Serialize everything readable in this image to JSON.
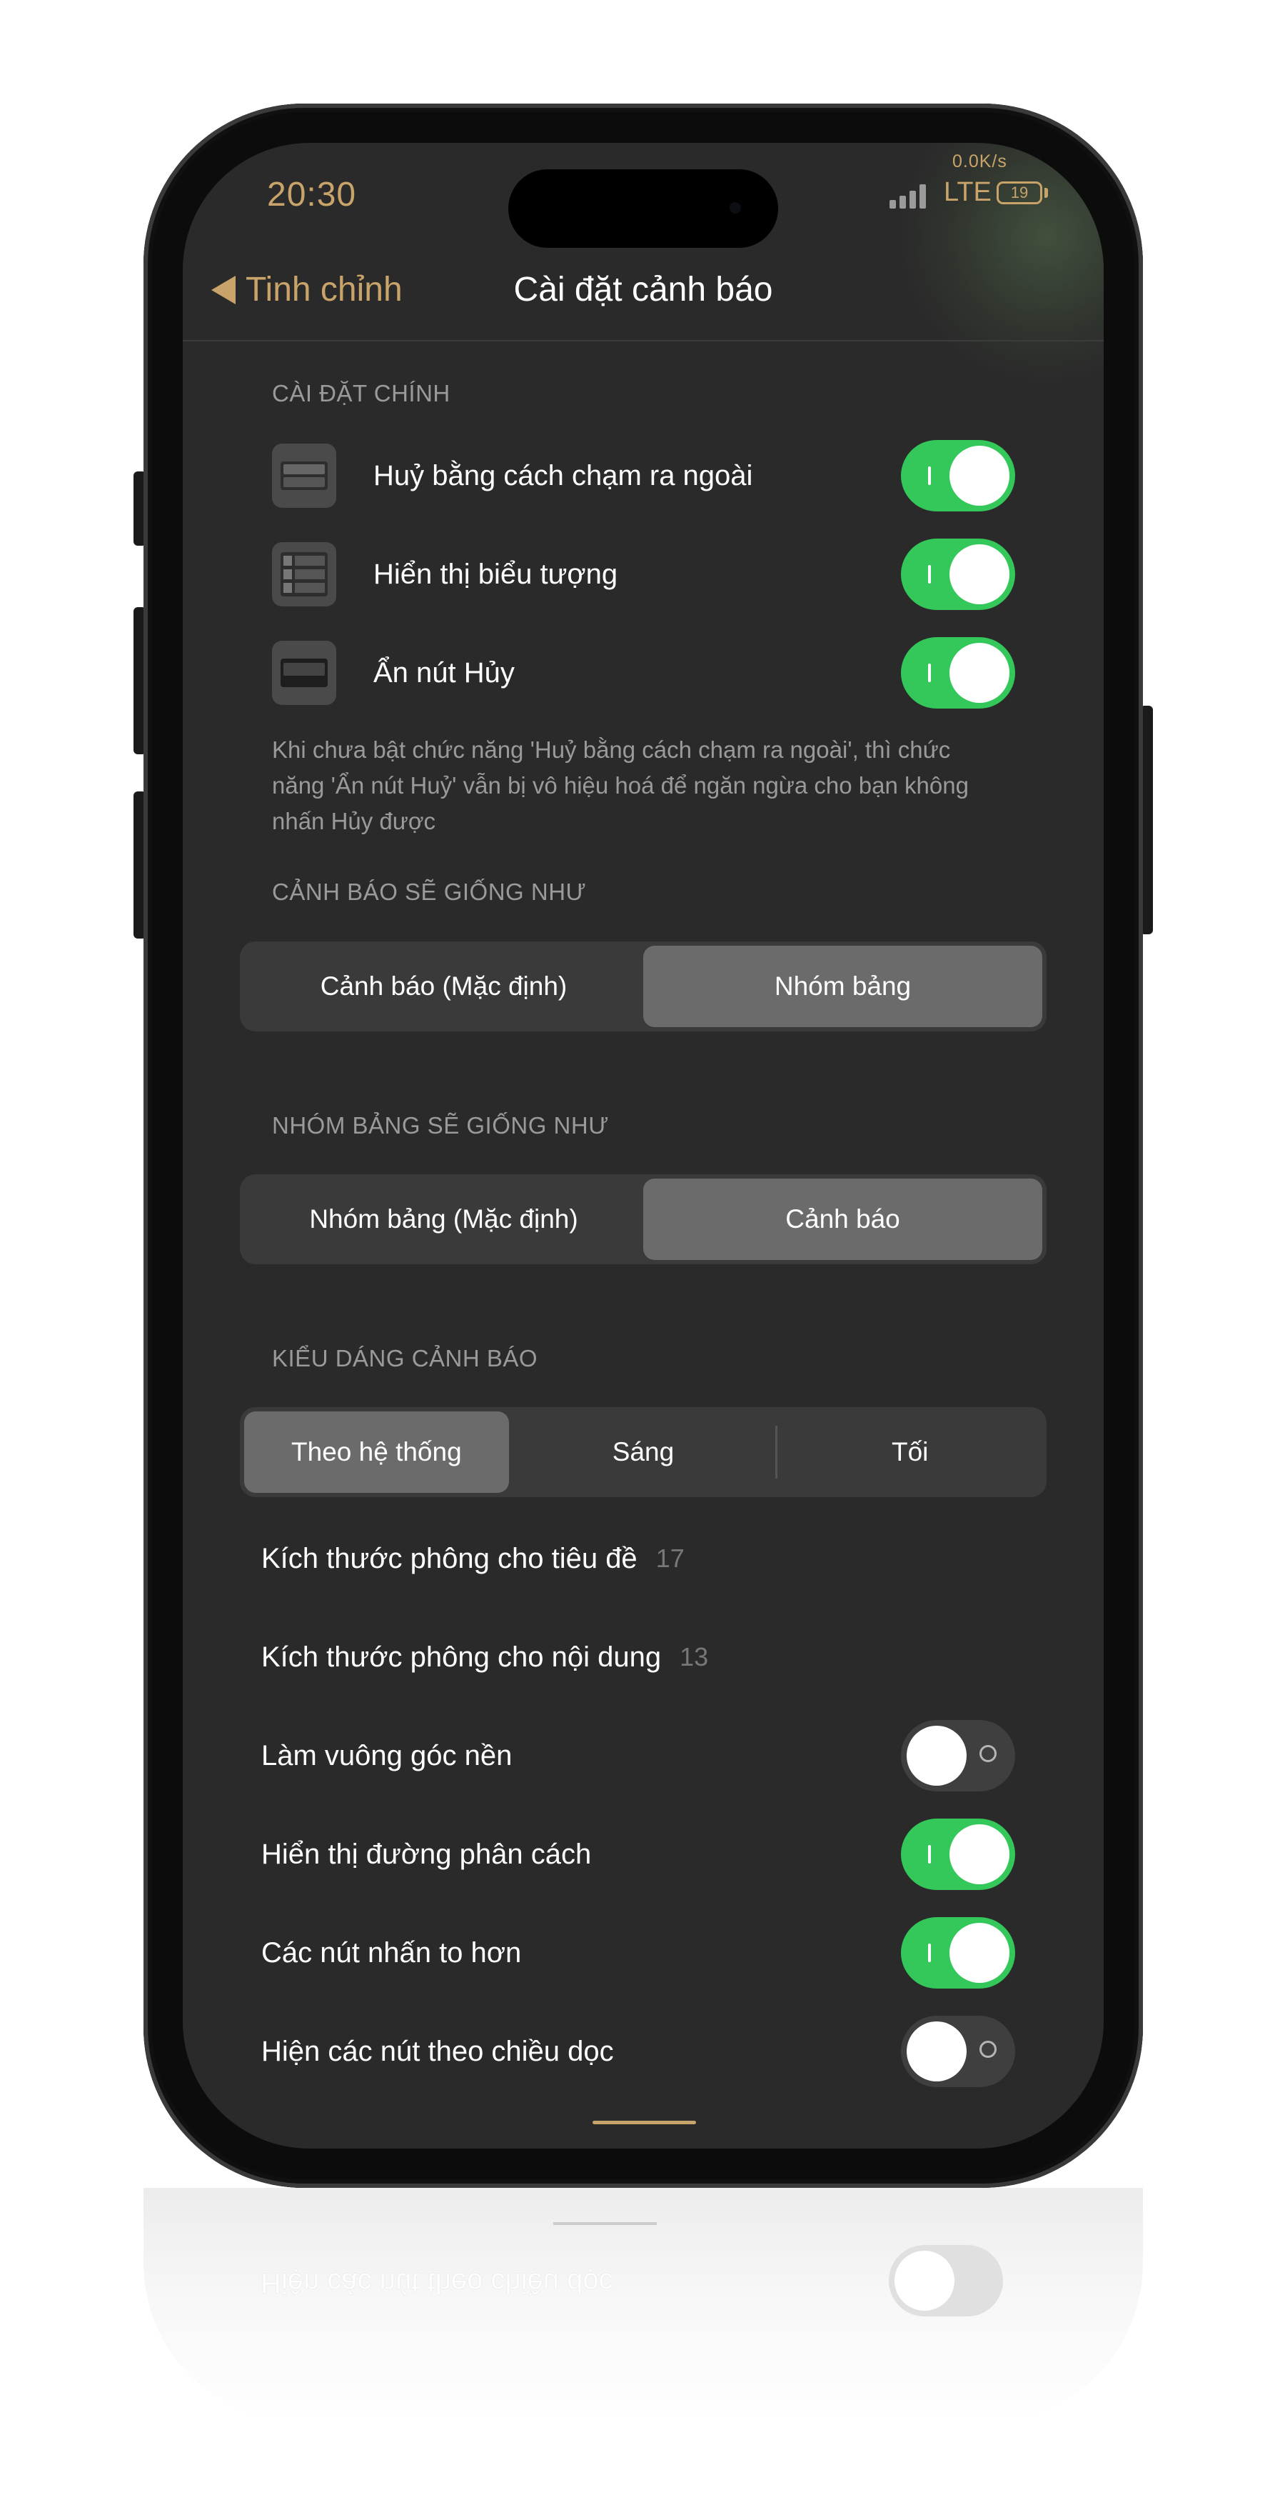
{
  "status_bar": {
    "time": "20:30",
    "net_speed": "0.0K/s",
    "network": "LTE",
    "battery": "19"
  },
  "nav": {
    "back_label": "Tinh chỉnh",
    "title": "Cài đặt cảnh báo"
  },
  "main_settings": {
    "header": "CÀI ĐẶT CHÍNH",
    "rows": [
      {
        "label": "Huỷ bằng cách chạm ra ngoài",
        "icon": "tap-outside-icon",
        "on": true
      },
      {
        "label": "Hiển thị biểu tượng",
        "icon": "list-icon",
        "on": true
      },
      {
        "label": "Ẩn nút Hủy",
        "icon": "hide-button-icon",
        "on": true
      }
    ],
    "footnote": "Khi chưa bật chức năng 'Huỷ bằng cách chạm ra ngoài', thì chức năng 'Ẩn nút Huỷ' vẫn bị vô hiệu hoá để ngăn ngừa cho bạn không nhấn Hủy được"
  },
  "alert_as": {
    "header": "CẢNH BÁO SẼ GIỐNG NHƯ",
    "options": [
      "Cảnh báo (Mặc định)",
      "Nhóm bảng"
    ],
    "selected": 1
  },
  "sheet_as": {
    "header": "NHÓM BẢNG SẼ GIỐNG NHƯ",
    "options": [
      "Nhóm bảng (Mặc định)",
      "Cảnh báo"
    ],
    "selected": 1
  },
  "alert_style": {
    "header": "KIỂU DÁNG CẢNH BÁO",
    "options": [
      "Theo hệ thống",
      "Sáng",
      "Tối"
    ],
    "selected": 0
  },
  "font_sizes": [
    {
      "label": "Kích thước phông cho tiêu đề",
      "value": "17"
    },
    {
      "label": "Kích thước phông cho nội dung",
      "value": "13"
    }
  ],
  "appearance_toggles": [
    {
      "label": "Làm vuông góc nền",
      "on": false
    },
    {
      "label": "Hiển thị đường phân cách",
      "on": true
    },
    {
      "label": "Các nút nhấn to hơn",
      "on": true
    },
    {
      "label": "Hiện các nút theo chiều dọc",
      "on": false
    }
  ],
  "colors": {
    "accent": "#c9a46a",
    "toggle_on": "#34c759",
    "background": "#2a2a2a",
    "segment_selected": "#6b6b6b"
  }
}
